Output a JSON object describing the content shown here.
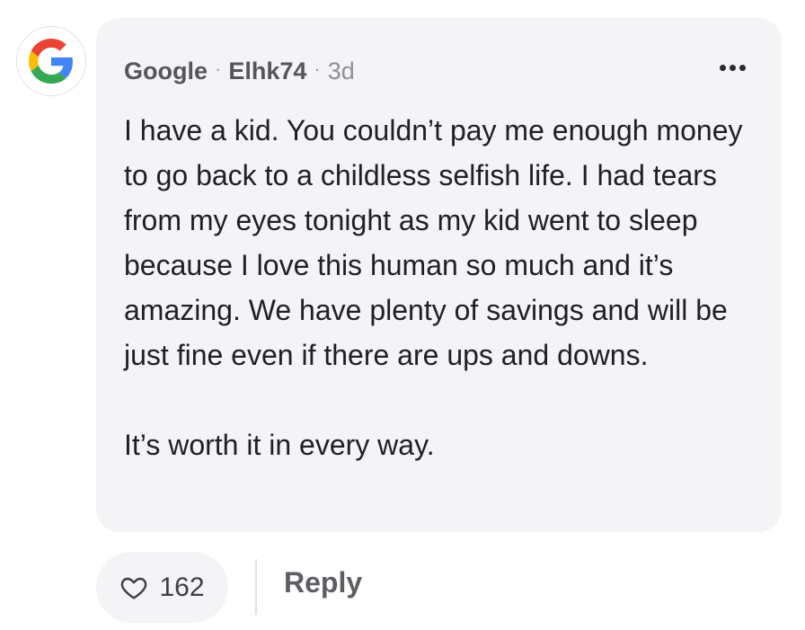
{
  "comment": {
    "avatar_icon": "google-g-logo",
    "author": "Google",
    "username": "Elhk74",
    "separator": "·",
    "time": "3d",
    "more_icon": "more-dots-icon",
    "paragraphs": [
      "I have a kid. You couldn’t pay me enough money to go back to a childless selfish life. I had tears from my eyes tonight as my kid went to sleep because I love this human so much and it’s amazing. We have plenty of savings and will be just fine even if there are ups and downs.",
      "It’s worth it in every way."
    ]
  },
  "actions": {
    "like_icon": "heart-icon",
    "like_count": "162",
    "reply_label": "Reply"
  },
  "colors": {
    "bubble_bg": "#f4f4f7",
    "google_blue": "#4285F4",
    "google_red": "#EA4335",
    "google_yellow": "#FBBC05",
    "google_green": "#34A853"
  }
}
